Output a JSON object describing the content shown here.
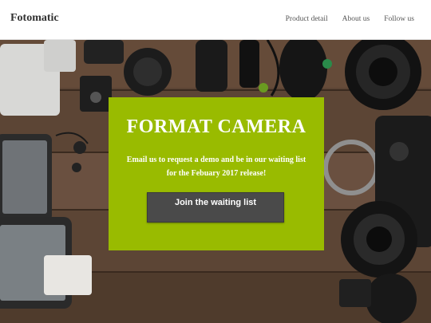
{
  "navbar": {
    "brand": "Fotomatic",
    "links": [
      "Product detail",
      "About us",
      "Follow us"
    ]
  },
  "hero": {
    "background_image": "camera-gear-on-wooden-table",
    "card": {
      "title": "FORMAT CAMERA",
      "text_line1": "Email us to request a demo and be in our waiting list",
      "text_line2": "for the Febuary 2017 release!",
      "button_label": "Join the waiting list",
      "card_color": "#99bb00",
      "button_color": "#4a4a4a"
    }
  }
}
